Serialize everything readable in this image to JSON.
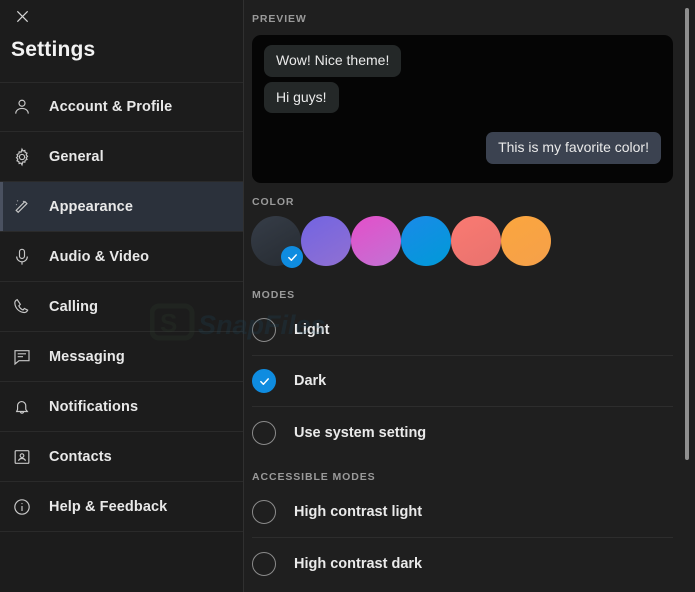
{
  "window": {
    "title": "Settings",
    "close_icon": "close-icon"
  },
  "sidebar": {
    "items": [
      {
        "label": "Account & Profile",
        "icon": "person-icon",
        "active": false
      },
      {
        "label": "General",
        "icon": "gear-icon",
        "active": false
      },
      {
        "label": "Appearance",
        "icon": "magic-wand-icon",
        "active": true
      },
      {
        "label": "Audio & Video",
        "icon": "microphone-icon",
        "active": false
      },
      {
        "label": "Calling",
        "icon": "phone-icon",
        "active": false
      },
      {
        "label": "Messaging",
        "icon": "chat-bubble-icon",
        "active": false
      },
      {
        "label": "Notifications",
        "icon": "bell-icon",
        "active": false
      },
      {
        "label": "Contacts",
        "icon": "contact-card-icon",
        "active": false
      },
      {
        "label": "Help & Feedback",
        "icon": "info-circle-icon",
        "active": false
      }
    ]
  },
  "main": {
    "preview": {
      "label": "PREVIEW",
      "messages": [
        {
          "text": "Wow! Nice theme!",
          "direction": "incoming"
        },
        {
          "text": "Hi guys!",
          "direction": "incoming"
        },
        {
          "text": "This is my favorite color!",
          "direction": "outgoing"
        }
      ],
      "background": "#050505",
      "incoming_bubble_color": "#242828",
      "outgoing_bubble_color": "#3b4250"
    },
    "color": {
      "label": "COLOR",
      "selected_index": 0,
      "check_badge_color": "#0f8ce0",
      "swatches": [
        {
          "name": "slate",
          "from": "#343b45",
          "to": "#272c33",
          "selected": true
        },
        {
          "name": "purple",
          "from": "#7b6ae0",
          "to": "#8a6fd6",
          "selected": false
        },
        {
          "name": "pink",
          "from": "#e055c8",
          "to": "#c969d8",
          "selected": false
        },
        {
          "name": "blue",
          "from": "#1390e8",
          "to": "#009ad9",
          "selected": false
        },
        {
          "name": "red",
          "from": "#f87171",
          "to": "#e8706f",
          "selected": false
        },
        {
          "name": "orange",
          "from": "#f9a23c",
          "to": "#f5a councils",
          "selected": false
        }
      ]
    },
    "modes": {
      "label": "MODES",
      "options": [
        {
          "label": "Light",
          "selected": false
        },
        {
          "label": "Dark",
          "selected": true
        },
        {
          "label": "Use system setting",
          "selected": false
        }
      ]
    },
    "accessible_modes": {
      "label": "ACCESSIBLE MODES",
      "options": [
        {
          "label": "High contrast light",
          "selected": false
        },
        {
          "label": "High contrast dark",
          "selected": false
        }
      ]
    }
  },
  "watermark": {
    "text": "SnapFiles"
  },
  "scrollbar": {
    "thumb_color": "#8f8f8f"
  }
}
